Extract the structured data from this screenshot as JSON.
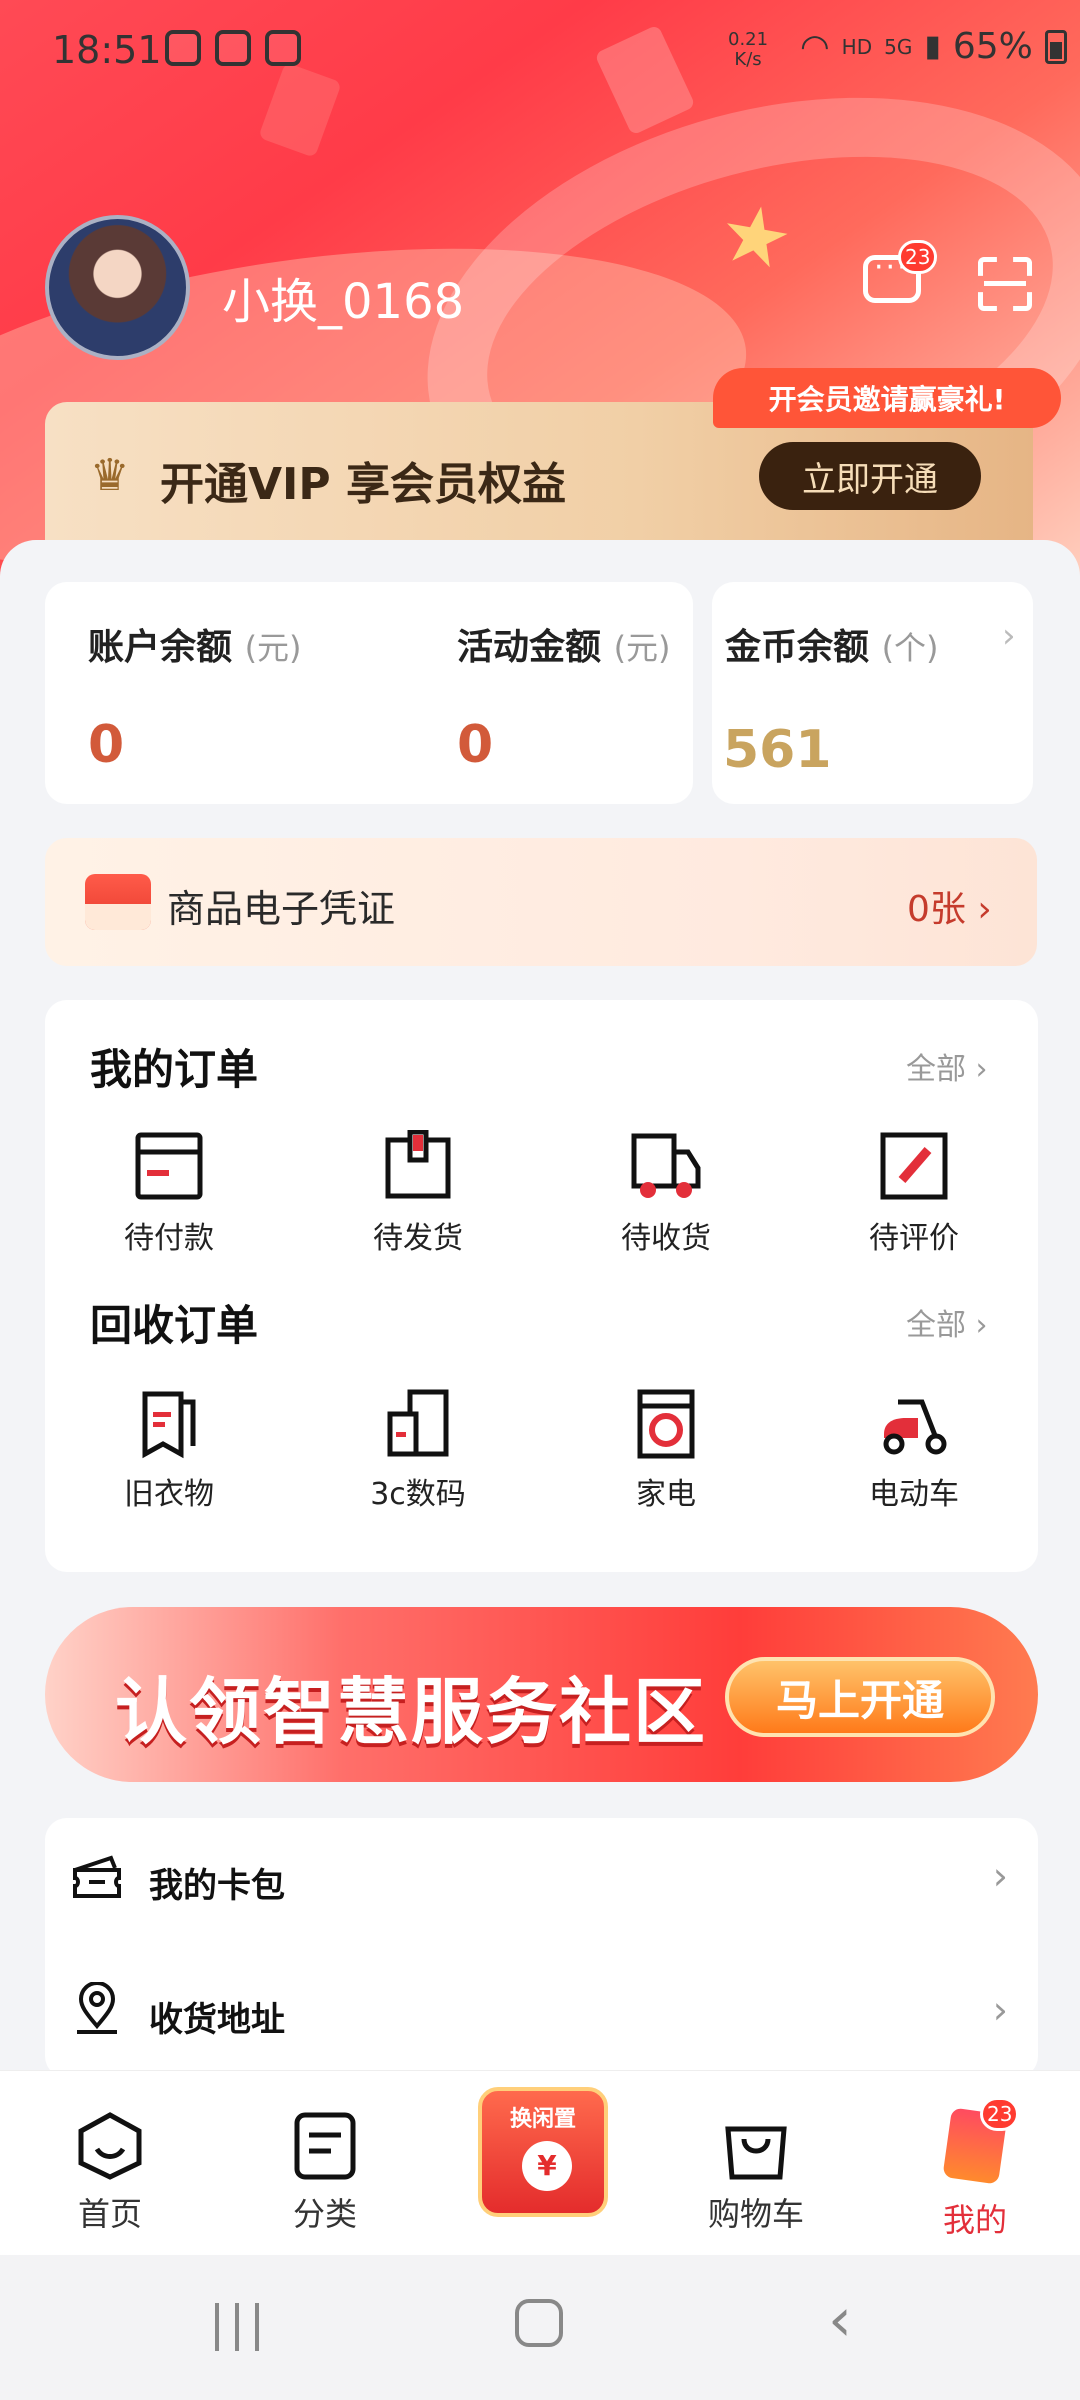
{
  "status": {
    "time": "18:51",
    "speed_value": "0.21",
    "speed_unit": "K/s",
    "network": "HD",
    "signal": "5G",
    "battery": "65%"
  },
  "header": {
    "username": "小换_0168",
    "message_badge": "23"
  },
  "vip": {
    "title": "开通VIP 享会员权益",
    "button": "立即开通",
    "tip": "开会员邀请赢豪礼!"
  },
  "balance": {
    "account_label": "账户余额",
    "account_unit": "(元)",
    "account_value": "0",
    "activity_label": "活动金额",
    "activity_unit": "(元)",
    "activity_value": "0",
    "coin_label": "金币余额",
    "coin_unit": "(个)",
    "coin_value": "561"
  },
  "voucher": {
    "label": "商品电子凭证",
    "count": "0张"
  },
  "orders": {
    "title": "我的订单",
    "all": "全部",
    "items": [
      {
        "label": "待付款",
        "icon": "wallet-icon"
      },
      {
        "label": "待发货",
        "icon": "box-icon"
      },
      {
        "label": "待收货",
        "icon": "truck-icon"
      },
      {
        "label": "待评价",
        "icon": "edit-icon"
      }
    ]
  },
  "recycle": {
    "title": "回收订单",
    "all": "全部",
    "items": [
      {
        "label": "旧衣物",
        "icon": "clothes-icon"
      },
      {
        "label": "3c数码",
        "icon": "devices-icon"
      },
      {
        "label": "家电",
        "icon": "washer-icon"
      },
      {
        "label": "电动车",
        "icon": "scooter-icon"
      }
    ]
  },
  "banner": {
    "text": "认领智慧服务社区",
    "button": "马上开通"
  },
  "menu": [
    {
      "label": "我的卡包",
      "icon": "ticket-icon"
    },
    {
      "label": "收货地址",
      "icon": "location-icon"
    }
  ],
  "tabbar": {
    "home": "首页",
    "category": "分类",
    "center": "换闲置",
    "cart": "购物车",
    "me": "我的",
    "me_badge": "23"
  },
  "colors": {
    "accent": "#e32f3a",
    "brand_red": "#ff3b48",
    "vip_dark": "#3a220f",
    "coin_gold": "#c9a45f"
  }
}
